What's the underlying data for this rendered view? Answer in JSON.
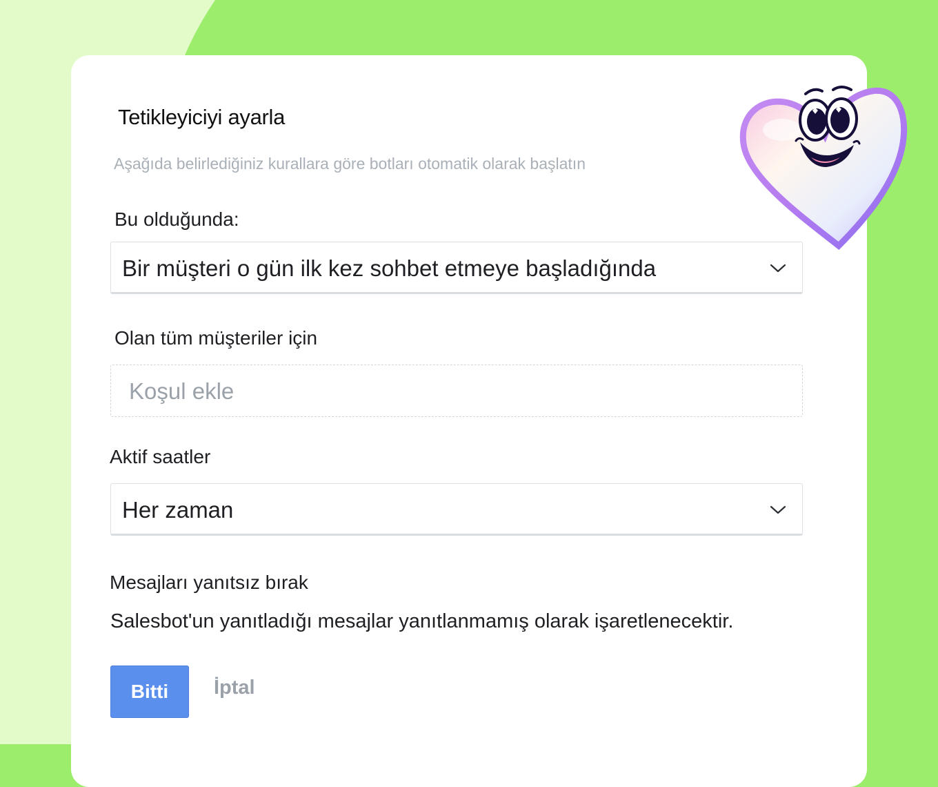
{
  "colors": {
    "background_green": "#9ced6c",
    "background_light": "#e2fbc9",
    "card": "#ffffff",
    "primary_button": "#5b8fee",
    "muted_text": "#9aa1a8"
  },
  "header": {
    "title": "Tetikleyiciyi ayarla",
    "subtitle": "Aşağıda belirlediğiniz kurallara göre botları otomatik olarak başlatın"
  },
  "trigger": {
    "label": "Bu olduğunda:",
    "selected": "Bir müşteri o gün ilk kez sohbet etmeye başladığında",
    "icon": "chevron-down-icon"
  },
  "conditions": {
    "label": "Olan tüm müşteriler için",
    "placeholder": "Koşul ekle"
  },
  "active_hours": {
    "label": "Aktif saatler",
    "selected": "Her zaman",
    "icon": "chevron-down-icon"
  },
  "unanswered": {
    "label": "Mesajları yanıtsız bırak",
    "description": "Salesbot'un yanıtladığı mesajlar yanıtlanmamış olarak işaretlenecektir."
  },
  "actions": {
    "done_label": "Bitti",
    "cancel_label": "İptal"
  },
  "decoration": {
    "mascot_icon": "smiling-heart-mascot-icon"
  }
}
